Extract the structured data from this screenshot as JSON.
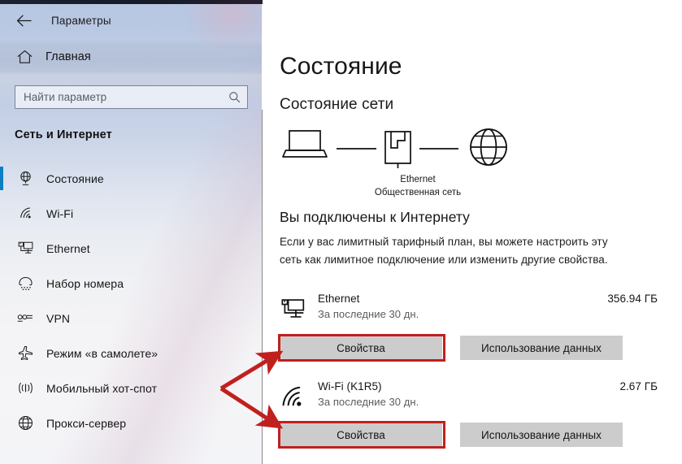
{
  "window": {
    "title": "Параметры",
    "back_icon": "back-arrow-icon"
  },
  "sidebar": {
    "home": {
      "label": "Главная",
      "icon": "home-icon"
    },
    "search": {
      "placeholder": "Найти параметр",
      "value": "",
      "icon": "search-icon"
    },
    "section_header": "Сеть и Интернет",
    "accent_color": "#0b7ec4",
    "items": [
      {
        "label": "Состояние",
        "icon": "network-status-icon",
        "selected": true
      },
      {
        "label": "Wi-Fi",
        "icon": "wifi-icon",
        "selected": false
      },
      {
        "label": "Ethernet",
        "icon": "ethernet-icon",
        "selected": false
      },
      {
        "label": "Набор номера",
        "icon": "dialup-icon",
        "selected": false
      },
      {
        "label": "VPN",
        "icon": "vpn-icon",
        "selected": false
      },
      {
        "label": "Режим «в самолете»",
        "icon": "airplane-icon",
        "selected": false
      },
      {
        "label": "Мобильный хот-спот",
        "icon": "hotspot-icon",
        "selected": false
      },
      {
        "label": "Прокси-сервер",
        "icon": "globe-icon",
        "selected": false
      }
    ]
  },
  "main": {
    "page_title": "Состояние",
    "section_title": "Состояние сети",
    "diagram": {
      "device_icon": "laptop-icon",
      "adapter_icon": "ethernet-port-icon",
      "internet_icon": "globe-icon",
      "adapter_label": "Ethernet",
      "network_type_label": "Общественная сеть"
    },
    "connection": {
      "heading": "Вы подключены к Интернету",
      "description": "Если у вас лимитный тарифный план, вы можете настроить эту сеть как лимитное подключение или изменить другие свойства."
    },
    "networks": [
      {
        "icon": "monitor-ethernet-icon",
        "name": "Ethernet",
        "period": "За последние 30 дн.",
        "usage": "356.94 ГБ",
        "properties_label": "Свойства",
        "data_usage_label": "Использование данных",
        "highlighted": true
      },
      {
        "icon": "wifi-icon",
        "name": "Wi-Fi (K1R5)",
        "period": "За последние 30 дн.",
        "usage": "2.67 ГБ",
        "properties_label": "Свойства",
        "data_usage_label": "Использование данных",
        "highlighted": true
      }
    ]
  },
  "annotation": {
    "color": "#c0201e",
    "description": "Красная стрелка с двумя наконечниками указывает на обе кнопки «Свойства»"
  }
}
